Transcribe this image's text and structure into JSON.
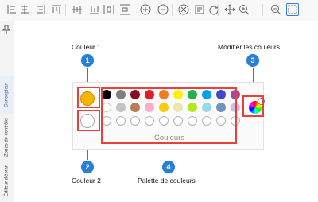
{
  "toolbar": {
    "icons": [
      "align-left-icon",
      "align-center-icon",
      "align-right-icon",
      "align-top-icon",
      "align-middle-icon",
      "align-bottom-icon",
      "distribute-horizontal-icon",
      "distribute-vertical-icon",
      "zoom-in-circle-icon",
      "zoom-out-circle-icon",
      "delete-circle-icon",
      "properties-icon",
      "refresh-icon",
      "move-icon",
      "zoom-in-icon",
      "zoom-out-icon",
      "select-area-icon"
    ]
  },
  "sidebar": {
    "tabs": [
      "Concepteur",
      "Zones de contrôle",
      "Éditeur d'écran"
    ],
    "active": "Concepteur"
  },
  "callouts": {
    "c1": {
      "number": "1",
      "label": "Couleur 1"
    },
    "c2": {
      "number": "2",
      "label": "Couleur 2"
    },
    "c3": {
      "number": "3",
      "label": "Modifier les couleurs"
    },
    "c4": {
      "number": "4",
      "label": "Palette de couleurs"
    }
  },
  "color_panel": {
    "title": "Couleurs",
    "color1": "#f5b700",
    "color2": "#ffffff",
    "row1": [
      "#000000",
      "#7f7f7f",
      "#8b0d22",
      "#e51b24",
      "#f47a20",
      "#fff200",
      "#22b14c",
      "#00a2e8",
      "#3f48cc",
      "#a349a4"
    ],
    "row2": [
      "#ffffff",
      "#c3c3c3",
      "#b97a57",
      "#ffaec9",
      "#ffc90e",
      "#efe4b0",
      "#b5e61d",
      "#99d9ea",
      "#7092be",
      "#c8bfe7"
    ],
    "row3_empty": 10
  },
  "colors": {
    "accent": "#2a7fd4",
    "highlight": "#e8413b"
  }
}
